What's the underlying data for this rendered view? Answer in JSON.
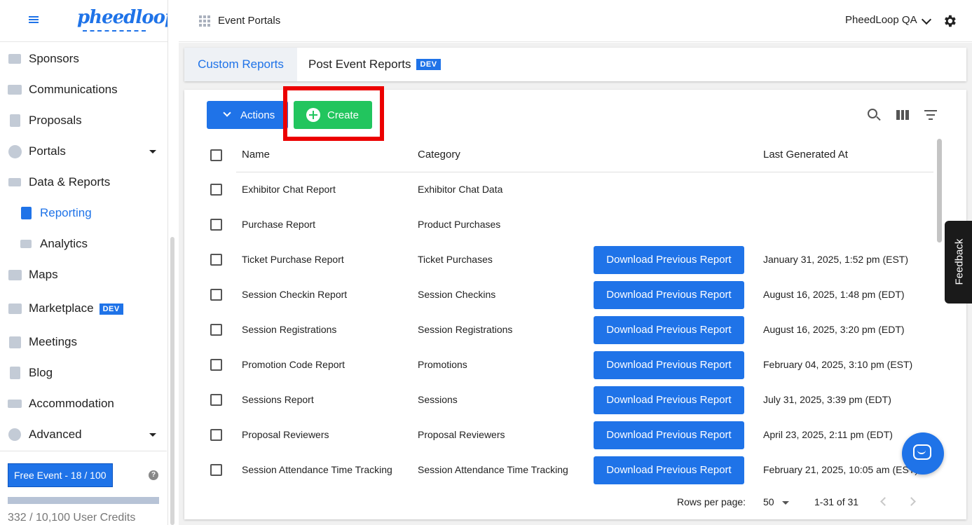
{
  "brand": {
    "logo_text": "pheedloop"
  },
  "topbar": {
    "title": "Event Portals",
    "org_name": "PheedLoop QA"
  },
  "sidebar": {
    "items": [
      {
        "label": "Sponsors"
      },
      {
        "label": "Communications"
      },
      {
        "label": "Proposals"
      },
      {
        "label": "Portals"
      },
      {
        "label": "Data & Reports"
      },
      {
        "label": "Reporting"
      },
      {
        "label": "Analytics"
      },
      {
        "label": "Maps"
      },
      {
        "label": "Marketplace",
        "badge": "DEV"
      },
      {
        "label": "Meetings"
      },
      {
        "label": "Blog"
      },
      {
        "label": "Accommodation"
      },
      {
        "label": "Advanced"
      }
    ],
    "plan_badge": "Free Event - 18 / 100",
    "help_glyph": "?",
    "credits_text": "332 / 10,100 User Credits"
  },
  "tabs": [
    {
      "label": "Custom Reports",
      "active": true
    },
    {
      "label": "Post Event Reports",
      "badge": "DEV"
    }
  ],
  "toolbar": {
    "actions_label": "Actions",
    "create_label": "Create"
  },
  "table": {
    "columns": [
      "Name",
      "Category",
      "",
      "Last Generated At"
    ],
    "download_label": "Download Previous Report",
    "rows": [
      {
        "name": "Exhibitor Chat Report",
        "category": "Exhibitor Chat Data",
        "last_generated": ""
      },
      {
        "name": "Purchase Report",
        "category": "Product Purchases",
        "last_generated": ""
      },
      {
        "name": "Ticket Purchase Report",
        "category": "Ticket Purchases",
        "last_generated": "January 31, 2025, 1:52 pm (EST)"
      },
      {
        "name": "Session Checkin Report",
        "category": "Session Checkins",
        "last_generated": "August 16, 2025, 1:48 pm (EDT)"
      },
      {
        "name": "Session Registrations",
        "category": "Session Registrations",
        "last_generated": "August 16, 2025, 3:20 pm (EDT)"
      },
      {
        "name": "Promotion Code Report",
        "category": "Promotions",
        "last_generated": "February 04, 2025, 3:10 pm (EST)"
      },
      {
        "name": "Sessions Report",
        "category": "Sessions",
        "last_generated": "July 31, 2025, 3:39 pm (EDT)"
      },
      {
        "name": "Proposal Reviewers",
        "category": "Proposal Reviewers",
        "last_generated": "April 23, 2025, 2:11 pm (EDT)"
      },
      {
        "name": "Session Attendance Time Tracking",
        "category": "Session Attendance Time Tracking",
        "last_generated": "February 21, 2025, 10:05 am (EST)"
      }
    ]
  },
  "pagination": {
    "rows_per_page_label": "Rows per page:",
    "rows_per_page": "50",
    "range": "1-31 of 31"
  },
  "feedback_label": "Feedback",
  "colors": {
    "primary": "#1f73e8",
    "success": "#22c55e",
    "highlight": "#ec0000"
  }
}
